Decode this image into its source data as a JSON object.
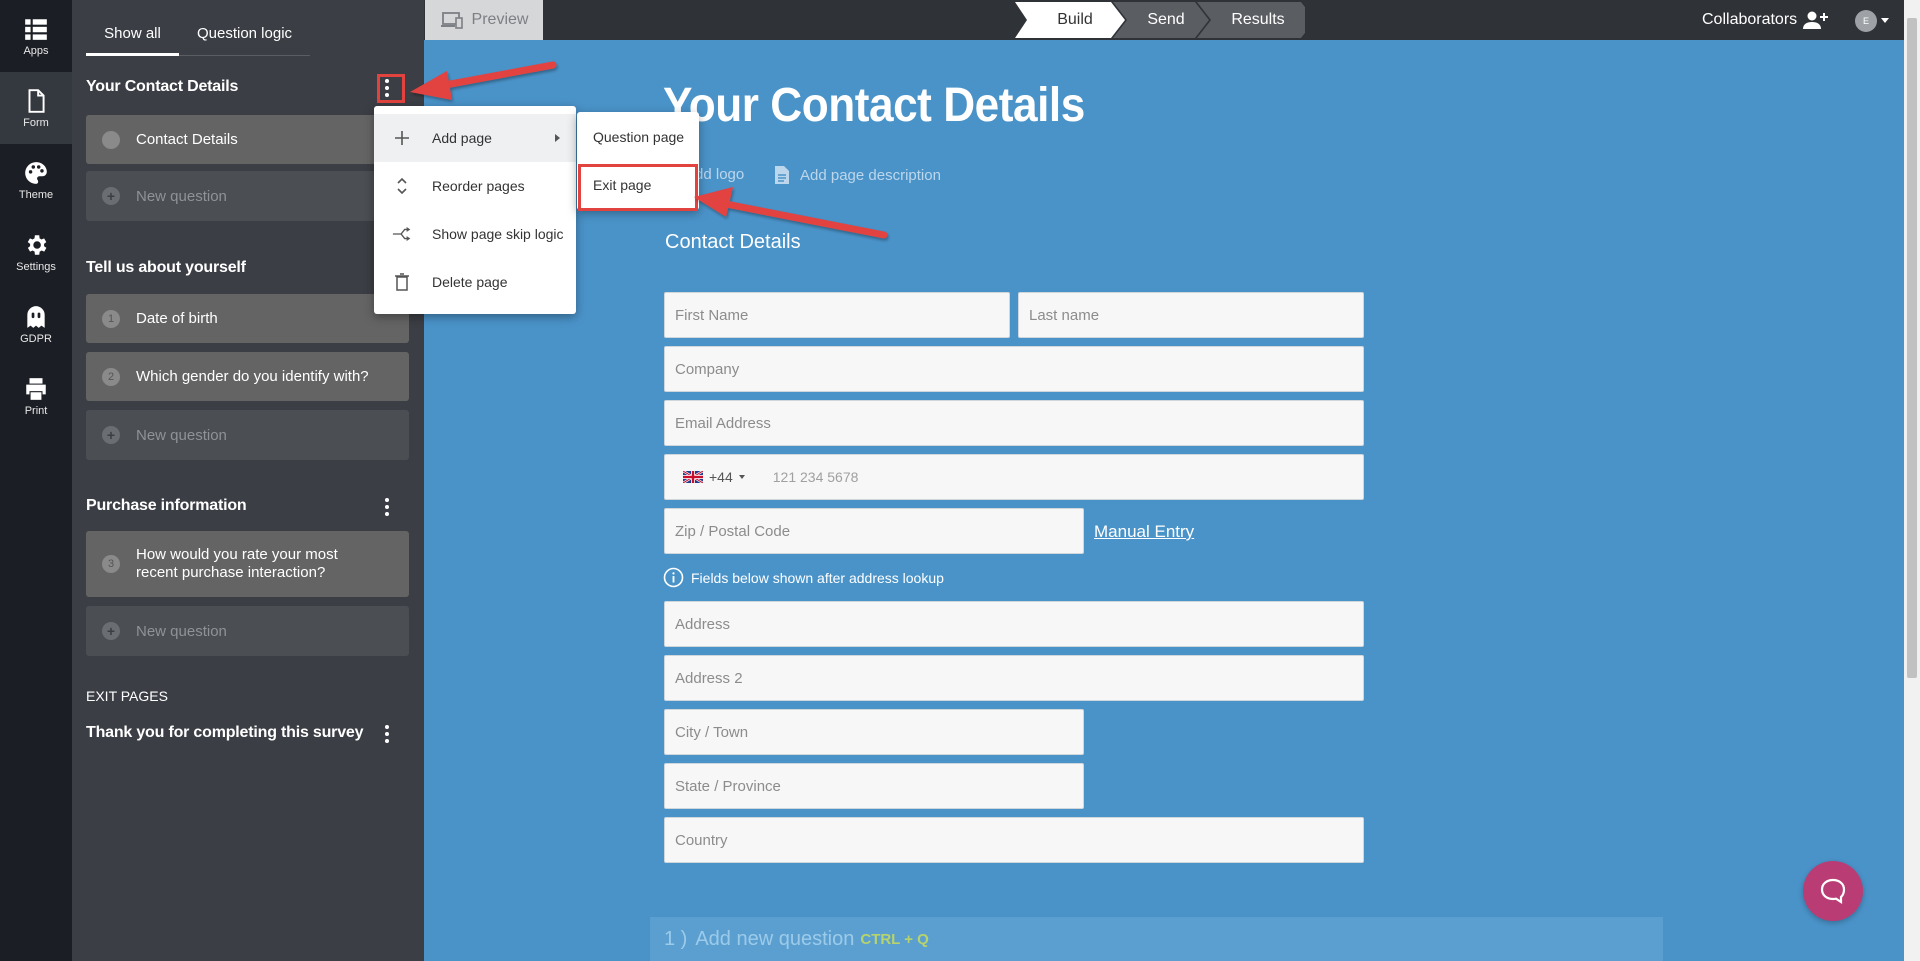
{
  "rail": {
    "items": [
      {
        "label": "Apps",
        "icon": "grid-icon"
      },
      {
        "label": "Form",
        "icon": "document-icon"
      },
      {
        "label": "Theme",
        "icon": "palette-icon"
      },
      {
        "label": "Settings",
        "icon": "gear-icon"
      },
      {
        "label": "GDPR",
        "icon": "ghost-icon"
      },
      {
        "label": "Print",
        "icon": "printer-icon"
      }
    ],
    "active": "Form"
  },
  "sidebar": {
    "tabs": [
      "Show all",
      "Question logic"
    ],
    "sections": [
      {
        "title": "Your Contact Details",
        "questions": [
          {
            "number": "",
            "text": "Contact Details"
          }
        ],
        "new_question": "New question"
      },
      {
        "title": "Tell us about yourself",
        "questions": [
          {
            "number": "1",
            "text": "Date of birth"
          },
          {
            "number": "2",
            "text": "Which gender do you identify with?"
          }
        ],
        "new_question": "New question"
      },
      {
        "title": "Purchase information",
        "questions": [
          {
            "number": "3",
            "text": "How would you rate your most recent purchase interaction?"
          }
        ],
        "new_question": "New question"
      }
    ],
    "exit_pages": {
      "heading": "EXIT PAGES",
      "items": [
        "Thank you for completing this survey"
      ]
    }
  },
  "context_menu": {
    "items": [
      "Add page",
      "Reorder pages",
      "Show page skip logic",
      "Delete page"
    ],
    "submenu": [
      "Question page",
      "Exit page"
    ]
  },
  "topbar": {
    "preview": "Preview",
    "steps": [
      "Build",
      "Send",
      "Results"
    ],
    "active_step": "Build",
    "collaborators": "Collaborators",
    "avatar_initial": "E"
  },
  "form": {
    "title": "Your Contact Details",
    "add_logo": "Add logo",
    "add_page_description": "Add page description",
    "section_heading": "Contact Details",
    "fields": {
      "first_name": "First Name",
      "last_name": "Last name",
      "company": "Company",
      "email": "Email Address",
      "phone_code": "+44",
      "phone_placeholder": "121 234 5678",
      "zip": "Zip / Postal Code",
      "manual_entry": "Manual Entry",
      "lookup_note": "Fields below shown after address lookup",
      "address": "Address",
      "address2": "Address 2",
      "city": "City / Town",
      "state": "State / Province",
      "country": "Country"
    },
    "add_question": {
      "prefix": "1 )",
      "label": "Add new question",
      "shortcut": "CTRL + Q"
    }
  },
  "colors": {
    "canvas": "#4a93c9",
    "sidebar": "#3b3e44",
    "rail": "#1b1e24",
    "annotation": "#e2433f",
    "chat": "#b93d74"
  }
}
